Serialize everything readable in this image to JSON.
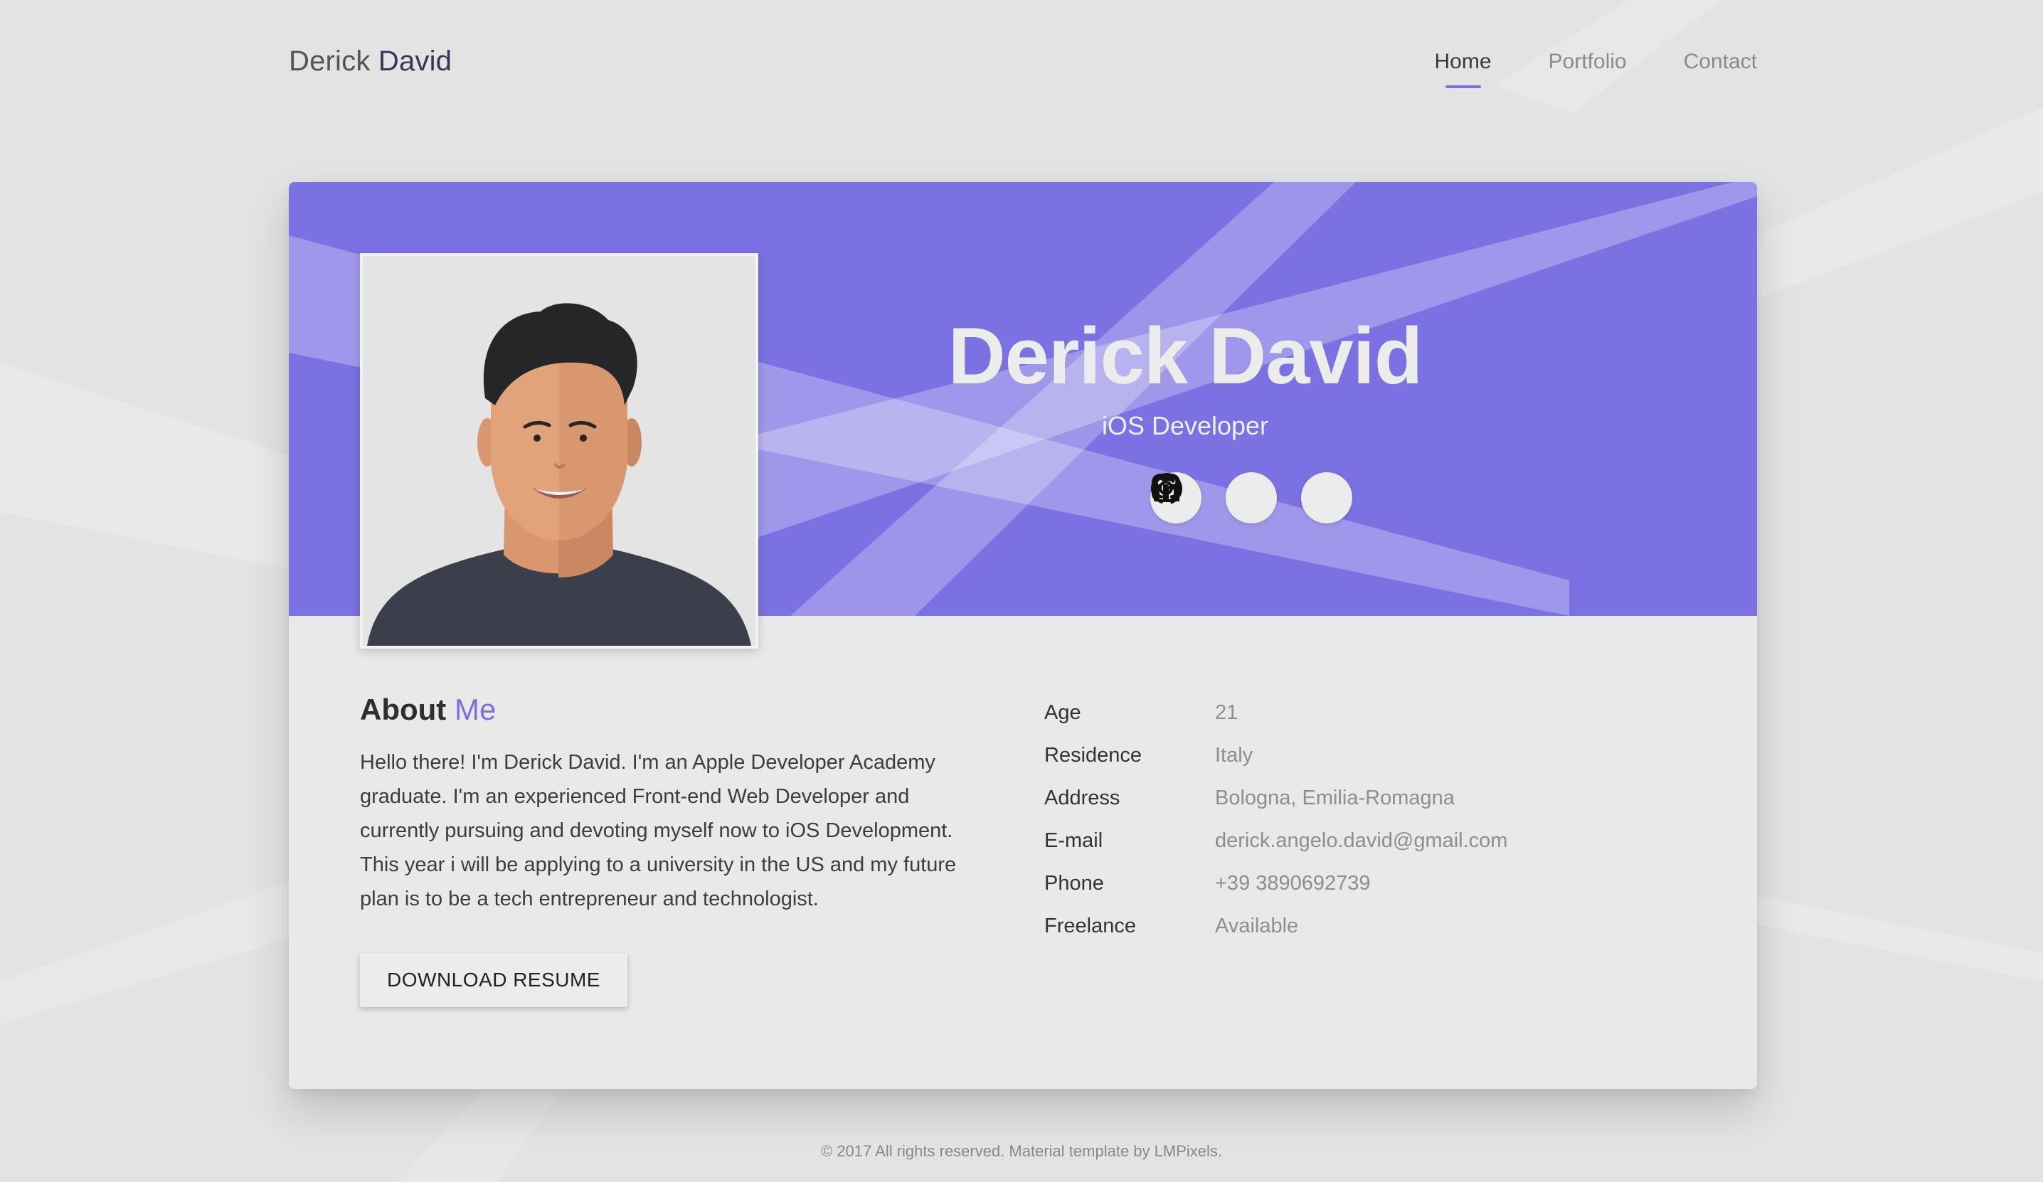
{
  "header": {
    "logo_first": "Derick",
    "logo_last": "David",
    "nav": [
      {
        "label": "Home",
        "active": true
      },
      {
        "label": "Portfolio",
        "active": false
      },
      {
        "label": "Contact",
        "active": false
      }
    ]
  },
  "hero": {
    "name": "Derick David",
    "role": "iOS Developer",
    "socials": [
      {
        "icon": "instagram-icon"
      },
      {
        "icon": "github-icon"
      },
      {
        "icon": "linkedin-icon"
      }
    ]
  },
  "about": {
    "title_main": "About",
    "title_accent": "Me",
    "text": "Hello there! I'm Derick David. I'm an Apple Developer Academy graduate. I'm an experienced Front-end Web Developer and currently pursuing and devoting myself now to iOS Development. This year i will be applying to a university in the US and my future plan is to be a tech entrepreneur and technologist.",
    "button_label": "DOWNLOAD RESUME"
  },
  "info": [
    {
      "label": "Age",
      "value": "21"
    },
    {
      "label": "Residence",
      "value": "Italy"
    },
    {
      "label": "Address",
      "value": "Bologna, Emilia-Romagna"
    },
    {
      "label": "E-mail",
      "value": "derick.angelo.david@gmail.com"
    },
    {
      "label": "Phone",
      "value": "+39 3890692739"
    },
    {
      "label": "Freelance",
      "value": "Available"
    }
  ],
  "footer": {
    "text": "© 2017 All rights reserved. Material template by LMPixels."
  },
  "colors": {
    "accent": "#7b70e0",
    "banner": "#7b71e2",
    "background": "#e3e3e3",
    "card": "#e9e9e9"
  }
}
